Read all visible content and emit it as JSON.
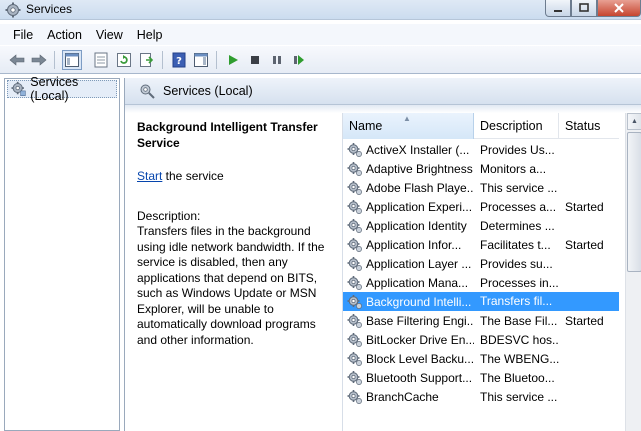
{
  "window": {
    "title": "Services"
  },
  "menu": [
    "File",
    "Action",
    "View",
    "Help"
  ],
  "toolbar": {
    "icons": [
      "back-arrow-icon",
      "forward-arrow-icon",
      "show-hide-tree-icon",
      "properties-icon",
      "refresh-icon",
      "export-list-icon",
      "help-icon",
      "show-hide-action-pane-icon",
      "start-service-icon",
      "stop-service-icon",
      "pause-service-icon",
      "restart-service-icon"
    ]
  },
  "tree": {
    "root_label": "Services (Local)"
  },
  "pane": {
    "header_label": "Services (Local)"
  },
  "details": {
    "service_name": "Background Intelligent Transfer Service",
    "start_link": "Start",
    "start_suffix": " the service",
    "description_title": "Description:",
    "description_text": "Transfers files in the background using idle network bandwidth. If the service is disabled, then any applications that depend on BITS, such as Windows Update or MSN Explorer, will be unable to automatically download programs and other information."
  },
  "list": {
    "columns": {
      "name": "Name",
      "description": "Description",
      "status": "Status"
    },
    "rows": [
      {
        "name": "ActiveX Installer (...",
        "description": "Provides Us...",
        "status": ""
      },
      {
        "name": "Adaptive Brightness",
        "description": "Monitors a...",
        "status": ""
      },
      {
        "name": "Adobe Flash Playe...",
        "description": "This service ...",
        "status": ""
      },
      {
        "name": "Application Experi...",
        "description": "Processes a...",
        "status": "Started"
      },
      {
        "name": "Application Identity",
        "description": "Determines ...",
        "status": ""
      },
      {
        "name": "Application Infor...",
        "description": "Facilitates t...",
        "status": "Started"
      },
      {
        "name": "Application Layer ...",
        "description": "Provides su...",
        "status": ""
      },
      {
        "name": "Application Mana...",
        "description": "Processes in...",
        "status": ""
      },
      {
        "name": "Background Intelli...",
        "description": "Transfers fil...",
        "status": "",
        "selected": true
      },
      {
        "name": "Base Filtering Engi...",
        "description": "The Base Fil...",
        "status": "Started"
      },
      {
        "name": "BitLocker Drive En...",
        "description": "BDESVC hos...",
        "status": ""
      },
      {
        "name": "Block Level Backu...",
        "description": "The WBENG...",
        "status": ""
      },
      {
        "name": "Bluetooth Support...",
        "description": "The Bluetoo...",
        "status": ""
      },
      {
        "name": "BranchCache",
        "description": "This service ...",
        "status": ""
      }
    ]
  },
  "colors": {
    "selection": "#3399ff",
    "link": "#0645ad"
  }
}
